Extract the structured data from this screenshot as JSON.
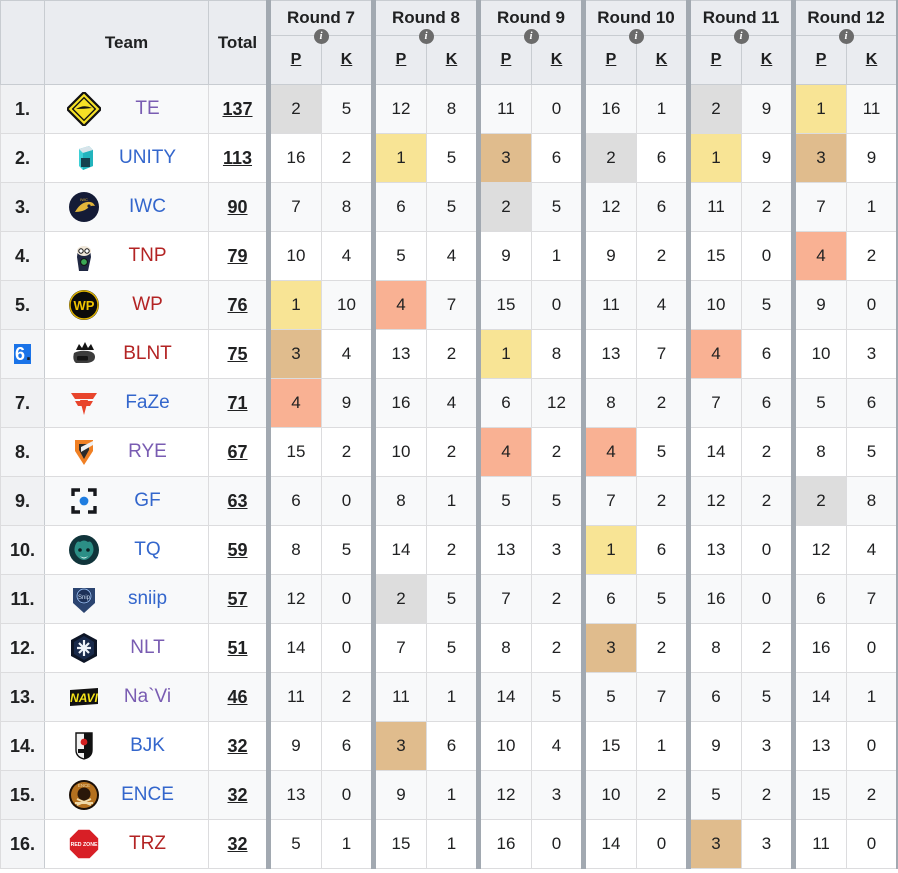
{
  "table": {
    "headers": {
      "rank": "",
      "team": "Team",
      "total": "Total",
      "sub_p": "P",
      "sub_k": "K",
      "info_glyph": "i",
      "info_icon_name": "info-icon"
    },
    "round_groups": [
      {
        "label": "Round 7"
      },
      {
        "label": "Round 8"
      },
      {
        "label": "Round 9"
      },
      {
        "label": "Round 10"
      },
      {
        "label": "Round 11"
      },
      {
        "label": "Round 12"
      }
    ],
    "colors": {
      "gold": "#f8e495",
      "bronze": "#e0bc8d",
      "salmon": "#f9b193",
      "grey": "#dddddd",
      "header_bg": "#eaecf0",
      "row_odd": "#f8f9fa",
      "row_even": "#ffffff",
      "link_blue": "#3366cc",
      "link_purple": "#795cb2",
      "link_red": "#b32424",
      "selection_blue": "#1a73e8"
    },
    "rows": [
      {
        "rank": "1.",
        "rank_selected": false,
        "team": "TE",
        "team_color": "c-purple",
        "logo": "te-logo",
        "total": "137",
        "cells": [
          {
            "v": "2",
            "hl": "hl-grey"
          },
          {
            "v": "5",
            "hl": ""
          },
          {
            "v": "12",
            "hl": ""
          },
          {
            "v": "8",
            "hl": ""
          },
          {
            "v": "11",
            "hl": ""
          },
          {
            "v": "0",
            "hl": ""
          },
          {
            "v": "16",
            "hl": ""
          },
          {
            "v": "1",
            "hl": ""
          },
          {
            "v": "2",
            "hl": "hl-grey"
          },
          {
            "v": "9",
            "hl": ""
          },
          {
            "v": "1",
            "hl": "hl-gold"
          },
          {
            "v": "11",
            "hl": ""
          }
        ]
      },
      {
        "rank": "2.",
        "rank_selected": false,
        "team": "UNITY",
        "team_color": "c-blue",
        "logo": "unity-logo",
        "total": "113",
        "cells": [
          {
            "v": "16",
            "hl": ""
          },
          {
            "v": "2",
            "hl": ""
          },
          {
            "v": "1",
            "hl": "hl-gold"
          },
          {
            "v": "5",
            "hl": ""
          },
          {
            "v": "3",
            "hl": "hl-bronze"
          },
          {
            "v": "6",
            "hl": ""
          },
          {
            "v": "2",
            "hl": "hl-grey"
          },
          {
            "v": "6",
            "hl": ""
          },
          {
            "v": "1",
            "hl": "hl-gold"
          },
          {
            "v": "9",
            "hl": ""
          },
          {
            "v": "3",
            "hl": "hl-bronze"
          },
          {
            "v": "9",
            "hl": ""
          }
        ]
      },
      {
        "rank": "3.",
        "rank_selected": false,
        "team": "IWC",
        "team_color": "c-blue",
        "logo": "iwc-logo",
        "total": "90",
        "cells": [
          {
            "v": "7",
            "hl": ""
          },
          {
            "v": "8",
            "hl": ""
          },
          {
            "v": "6",
            "hl": ""
          },
          {
            "v": "5",
            "hl": ""
          },
          {
            "v": "2",
            "hl": "hl-grey"
          },
          {
            "v": "5",
            "hl": ""
          },
          {
            "v": "12",
            "hl": ""
          },
          {
            "v": "6",
            "hl": ""
          },
          {
            "v": "11",
            "hl": ""
          },
          {
            "v": "2",
            "hl": ""
          },
          {
            "v": "7",
            "hl": ""
          },
          {
            "v": "1",
            "hl": ""
          }
        ]
      },
      {
        "rank": "4.",
        "rank_selected": false,
        "team": "TNP",
        "team_color": "c-red",
        "logo": "tnp-logo",
        "total": "79",
        "cells": [
          {
            "v": "10",
            "hl": ""
          },
          {
            "v": "4",
            "hl": ""
          },
          {
            "v": "5",
            "hl": ""
          },
          {
            "v": "4",
            "hl": ""
          },
          {
            "v": "9",
            "hl": ""
          },
          {
            "v": "1",
            "hl": ""
          },
          {
            "v": "9",
            "hl": ""
          },
          {
            "v": "2",
            "hl": ""
          },
          {
            "v": "15",
            "hl": ""
          },
          {
            "v": "0",
            "hl": ""
          },
          {
            "v": "4",
            "hl": "hl-salmon"
          },
          {
            "v": "2",
            "hl": ""
          }
        ]
      },
      {
        "rank": "5.",
        "rank_selected": false,
        "team": "WP",
        "team_color": "c-red",
        "logo": "wp-logo",
        "total": "76",
        "cells": [
          {
            "v": "1",
            "hl": "hl-gold"
          },
          {
            "v": "10",
            "hl": ""
          },
          {
            "v": "4",
            "hl": "hl-salmon"
          },
          {
            "v": "7",
            "hl": ""
          },
          {
            "v": "15",
            "hl": ""
          },
          {
            "v": "0",
            "hl": ""
          },
          {
            "v": "11",
            "hl": ""
          },
          {
            "v": "4",
            "hl": ""
          },
          {
            "v": "10",
            "hl": ""
          },
          {
            "v": "5",
            "hl": ""
          },
          {
            "v": "9",
            "hl": ""
          },
          {
            "v": "0",
            "hl": ""
          }
        ]
      },
      {
        "rank": "6.",
        "rank_selected": true,
        "team": "BLNT",
        "team_color": "c-red",
        "logo": "blnt-logo",
        "total": "75",
        "cells": [
          {
            "v": "3",
            "hl": "hl-bronze"
          },
          {
            "v": "4",
            "hl": ""
          },
          {
            "v": "13",
            "hl": ""
          },
          {
            "v": "2",
            "hl": ""
          },
          {
            "v": "1",
            "hl": "hl-gold"
          },
          {
            "v": "8",
            "hl": ""
          },
          {
            "v": "13",
            "hl": ""
          },
          {
            "v": "7",
            "hl": ""
          },
          {
            "v": "4",
            "hl": "hl-salmon"
          },
          {
            "v": "6",
            "hl": ""
          },
          {
            "v": "10",
            "hl": ""
          },
          {
            "v": "3",
            "hl": ""
          }
        ]
      },
      {
        "rank": "7.",
        "rank_selected": false,
        "team": "FaZe",
        "team_color": "c-blue",
        "logo": "faze-logo",
        "total": "71",
        "cells": [
          {
            "v": "4",
            "hl": "hl-salmon"
          },
          {
            "v": "9",
            "hl": ""
          },
          {
            "v": "16",
            "hl": ""
          },
          {
            "v": "4",
            "hl": ""
          },
          {
            "v": "6",
            "hl": ""
          },
          {
            "v": "12",
            "hl": ""
          },
          {
            "v": "8",
            "hl": ""
          },
          {
            "v": "2",
            "hl": ""
          },
          {
            "v": "7",
            "hl": ""
          },
          {
            "v": "6",
            "hl": ""
          },
          {
            "v": "5",
            "hl": ""
          },
          {
            "v": "6",
            "hl": ""
          }
        ]
      },
      {
        "rank": "8.",
        "rank_selected": false,
        "team": "RYE",
        "team_color": "c-purple",
        "logo": "rye-logo",
        "total": "67",
        "cells": [
          {
            "v": "15",
            "hl": ""
          },
          {
            "v": "2",
            "hl": ""
          },
          {
            "v": "10",
            "hl": ""
          },
          {
            "v": "2",
            "hl": ""
          },
          {
            "v": "4",
            "hl": "hl-salmon"
          },
          {
            "v": "2",
            "hl": ""
          },
          {
            "v": "4",
            "hl": "hl-salmon"
          },
          {
            "v": "5",
            "hl": ""
          },
          {
            "v": "14",
            "hl": ""
          },
          {
            "v": "2",
            "hl": ""
          },
          {
            "v": "8",
            "hl": ""
          },
          {
            "v": "5",
            "hl": ""
          }
        ]
      },
      {
        "rank": "9.",
        "rank_selected": false,
        "team": "GF",
        "team_color": "c-blue",
        "logo": "gf-logo",
        "total": "63",
        "cells": [
          {
            "v": "6",
            "hl": ""
          },
          {
            "v": "0",
            "hl": ""
          },
          {
            "v": "8",
            "hl": ""
          },
          {
            "v": "1",
            "hl": ""
          },
          {
            "v": "5",
            "hl": ""
          },
          {
            "v": "5",
            "hl": ""
          },
          {
            "v": "7",
            "hl": ""
          },
          {
            "v": "2",
            "hl": ""
          },
          {
            "v": "12",
            "hl": ""
          },
          {
            "v": "2",
            "hl": ""
          },
          {
            "v": "2",
            "hl": "hl-grey"
          },
          {
            "v": "8",
            "hl": ""
          }
        ]
      },
      {
        "rank": "10.",
        "rank_selected": false,
        "team": "TQ",
        "team_color": "c-blue",
        "logo": "tq-logo",
        "total": "59",
        "cells": [
          {
            "v": "8",
            "hl": ""
          },
          {
            "v": "5",
            "hl": ""
          },
          {
            "v": "14",
            "hl": ""
          },
          {
            "v": "2",
            "hl": ""
          },
          {
            "v": "13",
            "hl": ""
          },
          {
            "v": "3",
            "hl": ""
          },
          {
            "v": "1",
            "hl": "hl-gold"
          },
          {
            "v": "6",
            "hl": ""
          },
          {
            "v": "13",
            "hl": ""
          },
          {
            "v": "0",
            "hl": ""
          },
          {
            "v": "12",
            "hl": ""
          },
          {
            "v": "4",
            "hl": ""
          }
        ]
      },
      {
        "rank": "11.",
        "rank_selected": false,
        "team": "sniip",
        "team_color": "c-blue",
        "logo": "sniip-logo",
        "total": "57",
        "cells": [
          {
            "v": "12",
            "hl": ""
          },
          {
            "v": "0",
            "hl": ""
          },
          {
            "v": "2",
            "hl": "hl-grey"
          },
          {
            "v": "5",
            "hl": ""
          },
          {
            "v": "7",
            "hl": ""
          },
          {
            "v": "2",
            "hl": ""
          },
          {
            "v": "6",
            "hl": ""
          },
          {
            "v": "5",
            "hl": ""
          },
          {
            "v": "16",
            "hl": ""
          },
          {
            "v": "0",
            "hl": ""
          },
          {
            "v": "6",
            "hl": ""
          },
          {
            "v": "7",
            "hl": ""
          }
        ]
      },
      {
        "rank": "12.",
        "rank_selected": false,
        "team": "NLT",
        "team_color": "c-purple",
        "logo": "nlt-logo",
        "total": "51",
        "cells": [
          {
            "v": "14",
            "hl": ""
          },
          {
            "v": "0",
            "hl": ""
          },
          {
            "v": "7",
            "hl": ""
          },
          {
            "v": "5",
            "hl": ""
          },
          {
            "v": "8",
            "hl": ""
          },
          {
            "v": "2",
            "hl": ""
          },
          {
            "v": "3",
            "hl": "hl-bronze"
          },
          {
            "v": "2",
            "hl": ""
          },
          {
            "v": "8",
            "hl": ""
          },
          {
            "v": "2",
            "hl": ""
          },
          {
            "v": "16",
            "hl": ""
          },
          {
            "v": "0",
            "hl": ""
          }
        ]
      },
      {
        "rank": "13.",
        "rank_selected": false,
        "team": "Na`Vi",
        "team_color": "c-purple",
        "logo": "navi-logo",
        "total": "46",
        "cells": [
          {
            "v": "11",
            "hl": ""
          },
          {
            "v": "2",
            "hl": ""
          },
          {
            "v": "11",
            "hl": ""
          },
          {
            "v": "1",
            "hl": ""
          },
          {
            "v": "14",
            "hl": ""
          },
          {
            "v": "5",
            "hl": ""
          },
          {
            "v": "5",
            "hl": ""
          },
          {
            "v": "7",
            "hl": ""
          },
          {
            "v": "6",
            "hl": ""
          },
          {
            "v": "5",
            "hl": ""
          },
          {
            "v": "14",
            "hl": ""
          },
          {
            "v": "1",
            "hl": ""
          }
        ]
      },
      {
        "rank": "14.",
        "rank_selected": false,
        "team": "BJK",
        "team_color": "c-blue",
        "logo": "bjk-logo",
        "total": "32",
        "cells": [
          {
            "v": "9",
            "hl": ""
          },
          {
            "v": "6",
            "hl": ""
          },
          {
            "v": "3",
            "hl": "hl-bronze"
          },
          {
            "v": "6",
            "hl": ""
          },
          {
            "v": "10",
            "hl": ""
          },
          {
            "v": "4",
            "hl": ""
          },
          {
            "v": "15",
            "hl": ""
          },
          {
            "v": "1",
            "hl": ""
          },
          {
            "v": "9",
            "hl": ""
          },
          {
            "v": "3",
            "hl": ""
          },
          {
            "v": "13",
            "hl": ""
          },
          {
            "v": "0",
            "hl": ""
          }
        ]
      },
      {
        "rank": "15.",
        "rank_selected": false,
        "team": "ENCE",
        "team_color": "c-blue",
        "logo": "ence-logo",
        "total": "32",
        "cells": [
          {
            "v": "13",
            "hl": ""
          },
          {
            "v": "0",
            "hl": ""
          },
          {
            "v": "9",
            "hl": ""
          },
          {
            "v": "1",
            "hl": ""
          },
          {
            "v": "12",
            "hl": ""
          },
          {
            "v": "3",
            "hl": ""
          },
          {
            "v": "10",
            "hl": ""
          },
          {
            "v": "2",
            "hl": ""
          },
          {
            "v": "5",
            "hl": ""
          },
          {
            "v": "2",
            "hl": ""
          },
          {
            "v": "15",
            "hl": ""
          },
          {
            "v": "2",
            "hl": ""
          }
        ]
      },
      {
        "rank": "16.",
        "rank_selected": false,
        "team": "TRZ",
        "team_color": "c-red",
        "logo": "trz-logo",
        "total": "32",
        "cells": [
          {
            "v": "5",
            "hl": ""
          },
          {
            "v": "1",
            "hl": ""
          },
          {
            "v": "15",
            "hl": ""
          },
          {
            "v": "1",
            "hl": ""
          },
          {
            "v": "16",
            "hl": ""
          },
          {
            "v": "0",
            "hl": ""
          },
          {
            "v": "14",
            "hl": ""
          },
          {
            "v": "0",
            "hl": ""
          },
          {
            "v": "3",
            "hl": "hl-bronze"
          },
          {
            "v": "3",
            "hl": ""
          },
          {
            "v": "11",
            "hl": ""
          },
          {
            "v": "0",
            "hl": ""
          }
        ]
      }
    ]
  }
}
